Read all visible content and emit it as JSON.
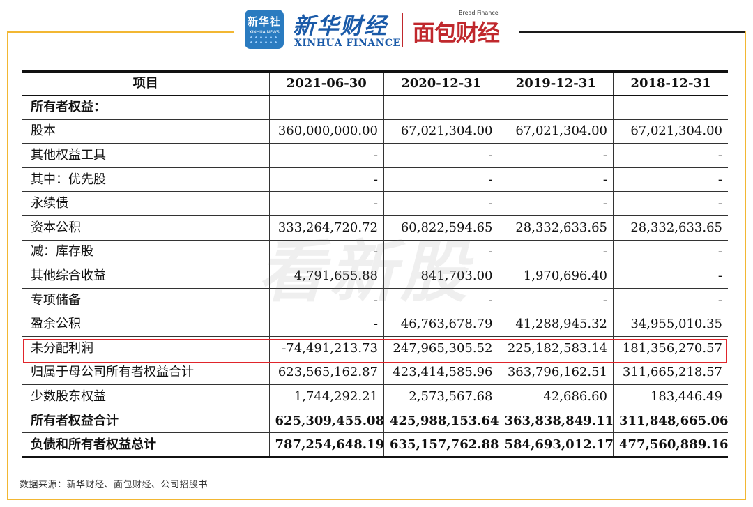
{
  "header": {
    "xinhua_logo_cn": "新华社",
    "xinhua_logo_en": "XINHUA NEWS",
    "brand_cn": "新华财经",
    "brand_en": "XINHUA FINANCE",
    "bread_en": "Bread Finance",
    "bread_cn": "面包财经"
  },
  "watermark": "看新股",
  "table": {
    "columns": [
      "项目",
      "2021-06-30",
      "2020-12-31",
      "2019-12-31",
      "2018-12-31"
    ],
    "rows": [
      {
        "label": "所有者权益：",
        "values": [
          "",
          "",
          "",
          ""
        ],
        "bold": true
      },
      {
        "label": "股本",
        "values": [
          "360,000,000.00",
          "67,021,304.00",
          "67,021,304.00",
          "67,021,304.00"
        ]
      },
      {
        "label": "其他权益工具",
        "values": [
          "-",
          "-",
          "-",
          "-"
        ]
      },
      {
        "label": "其中：优先股",
        "values": [
          "-",
          "-",
          "-",
          "-"
        ]
      },
      {
        "label": "永续债",
        "values": [
          "-",
          "-",
          "-",
          "-"
        ]
      },
      {
        "label": "资本公积",
        "values": [
          "333,264,720.72",
          "60,822,594.65",
          "28,332,633.65",
          "28,332,633.65"
        ]
      },
      {
        "label": "减：库存股",
        "values": [
          "-",
          "-",
          "-",
          "-"
        ]
      },
      {
        "label": "其他综合收益",
        "values": [
          "4,791,655.88",
          "841,703.00",
          "1,970,696.40",
          "-"
        ]
      },
      {
        "label": "专项储备",
        "values": [
          "-",
          "-",
          "-",
          "-"
        ]
      },
      {
        "label": "盈余公积",
        "values": [
          "-",
          "46,763,678.79",
          "41,288,945.32",
          "34,955,010.35"
        ]
      },
      {
        "label": "未分配利润",
        "values": [
          "-74,491,213.73",
          "247,965,305.52",
          "225,182,583.14",
          "181,356,270.57"
        ]
      },
      {
        "label": "归属于母公司所有者权益合计",
        "values": [
          "623,565,162.87",
          "423,414,585.96",
          "363,796,162.51",
          "311,665,218.57"
        ]
      },
      {
        "label": "少数股东权益",
        "values": [
          "1,744,292.21",
          "2,573,567.68",
          "42,686.60",
          "183,446.49"
        ]
      },
      {
        "label": "所有者权益合计",
        "values": [
          "625,309,455.08",
          "425,988,153.64",
          "363,838,849.11",
          "311,848,665.06"
        ],
        "bold": true
      },
      {
        "label": "负债和所有者权益总计",
        "values": [
          "787,254,648.19",
          "635,157,762.88",
          "584,693,012.17",
          "477,560,889.16"
        ],
        "bold": true
      }
    ]
  },
  "source": "数据来源：新华财经、面包财经、公司招股书",
  "colors": {
    "frame": "#f2b733",
    "highlight": "#e0252b",
    "brand_blue": "#1a5aa8",
    "bread_red": "#c0282d"
  }
}
